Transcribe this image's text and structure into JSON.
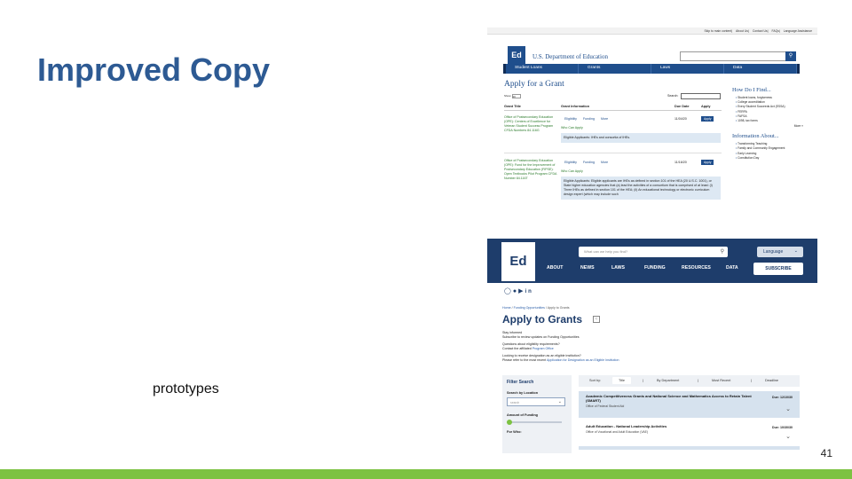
{
  "slide": {
    "title": "Improved Copy",
    "caption": "prototypes",
    "page_number": "41",
    "accent_color": "#7dc242",
    "title_color": "#2d5a93"
  },
  "old_site": {
    "utility_links": [
      "Skip to main content",
      "About Us",
      "Contact Us",
      "FAQs",
      "Language Assistance"
    ],
    "logo_text": "Ed",
    "agency_name": "U.S. Department of Education",
    "search_button_icon": "search-icon",
    "nav": [
      "Student Loans",
      "Grants",
      "Laws",
      "Data"
    ],
    "page_title": "Apply for a Grant",
    "show_label": "Show",
    "show_value": "10",
    "search_label": "Search:",
    "table_headers": {
      "grant_title": "Grant Title",
      "grant_info": "Grant Information",
      "due_date": "Due Date",
      "apply": "Apply"
    },
    "actions": {
      "eligibility": "Eligibility",
      "funding": "Funding",
      "more": "More",
      "who_can_apply": "Who Can Apply",
      "apply_button": "Apply"
    },
    "rows": [
      {
        "title": "Office of Postsecondary Education (OPE): Centers of Excellence for Veteran Student Success Program CFDA Numbers 84.116G",
        "due": "11/04/20",
        "eligibility": "Eligible Applicants: IHEs and consortia of IHEs."
      },
      {
        "title": "Office of Postsecondary Education (OPE): Fund for the Improvement of Postsecondary Education (FIPSE): Open Textbooks Pilot Program CFDA Number 84.116T",
        "due": "11/16/20",
        "eligibility": "Eligible Applicants: Eligible applicants are IHEs as defined in section 101 of the HEA (20 U.S.C. 1001), or State higher education agencies that (a) lead the activities of a consortium that is comprised of at least: (i) Three IHEs as defined in section 101 of the HEA; (ii) An educational technology or electronic curriculum design expert (which may include such"
      }
    ],
    "sidebar": {
      "how_heading": "How Do I Find...",
      "how_items": [
        "Student loans, forgiveness",
        "College accreditation",
        "Every Student Succeeds Act (ESSA)",
        "FERPA",
        "FAFSA",
        "1098, tax forms"
      ],
      "more_label": "More »",
      "info_heading": "Information About...",
      "info_items": [
        "Transforming Teaching",
        "Family and Community Engagement",
        "Early Learning",
        "Constitution Day"
      ]
    }
  },
  "new_site": {
    "logo_text": "Ed",
    "search_placeholder": "What can we help you find?",
    "language_label": "Language",
    "nav": [
      "ABOUT",
      "NEWS",
      "LAWS",
      "FUNDING",
      "RESOURCES",
      "DATA"
    ],
    "subscribe_label": "SUBSCRIBE",
    "social_icons": [
      "instagram-icon",
      "facebook-icon",
      "youtube-icon",
      "linkedin-icon"
    ],
    "breadcrumb": {
      "home": "Home",
      "funding": "Funding Opportunities",
      "current": "Apply to Grants"
    },
    "page_title": "Apply to Grants",
    "intro": {
      "stay_informed": "Stay informed",
      "subscribe_line": "Subscribe to review updates on Funding Opportunities",
      "questions": "Questions about eligibility requirements?",
      "contact_prefix": "Contact the affiliated",
      "contact_link": "Program Office",
      "looking": "Looking to receive designation as an eligible institution?",
      "refer_prefix": "Please refer to the most recent",
      "refer_link": "Application for Designation as an Eligible Institution"
    },
    "filter": {
      "heading": "Filter Search",
      "location_label": "Search by Location",
      "location_placeholder": "search",
      "funding_label": "Amount of Funding",
      "funding_fraction": 0.0,
      "who_label": "For Who:"
    },
    "sort": {
      "label": "Sort by:",
      "options": [
        "Title",
        "By Department",
        "Most Recent",
        "Deadline"
      ],
      "active": "Title"
    },
    "results": [
      {
        "title": "Academic Competitiveness Grants and National Science and Mathematics Access to Retain Talent (SMART)",
        "office": "Office of Federal Student Aid",
        "due": "Due: 12/10/30"
      },
      {
        "title": "Adult Education - National Leadership Activities",
        "office": "Office of Vocational and Adult Education (VAE)",
        "due": "Due: 10/30/30"
      }
    ]
  }
}
